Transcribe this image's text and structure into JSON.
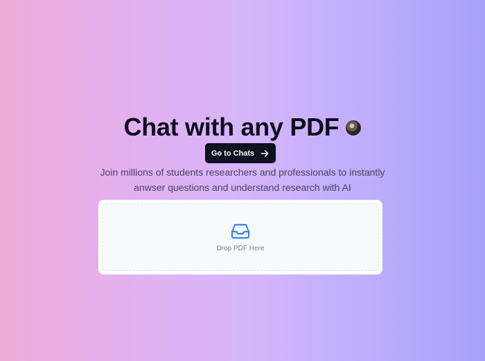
{
  "hero": {
    "title": "Chat with any PDF",
    "cta_label": "Go to Chats",
    "subtitle_line1": "Join millions of students researchers and professionals to instantly",
    "subtitle_line2": "anwser questions and understand research with AI"
  },
  "upload": {
    "label": "Drop PDF Here",
    "icon": "inbox-icon"
  },
  "colors": {
    "accent_icon": "#3b82f6",
    "button_bg": "#0f1020",
    "gradient_left": "#efacd9",
    "gradient_right": "#a6a2fa"
  },
  "icons": {
    "cta": "arrow-right-icon",
    "user": "avatar"
  }
}
